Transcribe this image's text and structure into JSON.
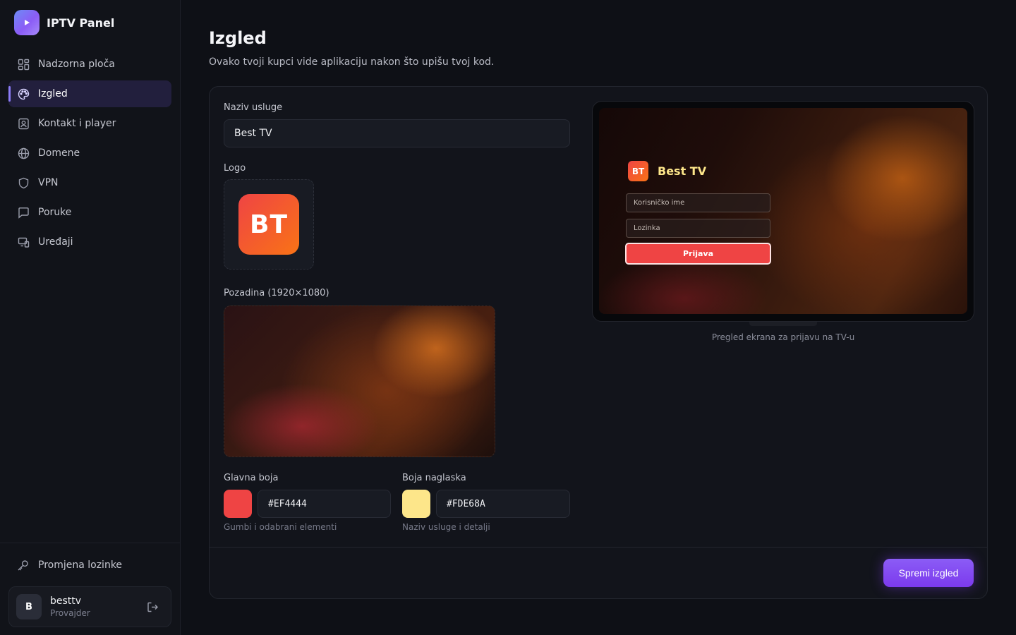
{
  "app": {
    "title": "IPTV Panel"
  },
  "sidebar": {
    "items": [
      {
        "label": "Nadzorna ploča",
        "icon": "dashboard-icon"
      },
      {
        "label": "Izgled",
        "icon": "palette-icon",
        "active": true
      },
      {
        "label": "Kontakt i player",
        "icon": "contact-icon"
      },
      {
        "label": "Domene",
        "icon": "globe-icon"
      },
      {
        "label": "VPN",
        "icon": "shield-icon"
      },
      {
        "label": "Poruke",
        "icon": "message-icon"
      },
      {
        "label": "Uređaji",
        "icon": "devices-icon"
      }
    ],
    "change_password": "Promjena lozinke",
    "user": {
      "initial": "B",
      "name": "besttv",
      "role": "Provajder"
    }
  },
  "page": {
    "title": "Izgled",
    "subtitle": "Ovako tvoji kupci vide aplikaciju nakon što upišu tvoj kod."
  },
  "form": {
    "service_name_label": "Naziv usluge",
    "service_name_value": "Best TV",
    "logo_label": "Logo",
    "logo_text": "BT",
    "background_label": "Pozadina (1920×1080)",
    "primary_color_label": "Glavna boja",
    "primary_color_value": "#EF4444",
    "primary_color_hint": "Gumbi i odabrani elementi",
    "accent_color_label": "Boja naglaska",
    "accent_color_value": "#FDE68A",
    "accent_color_hint": "Naziv usluge i detalji",
    "save_label": "Spremi izgled"
  },
  "preview": {
    "logo_text": "BT",
    "title": "Best TV",
    "username_placeholder": "Korisničko ime",
    "password_placeholder": "Lozinka",
    "login_label": "Prijava",
    "caption": "Pregled ekrana za prijavu na TV-u"
  },
  "colors": {
    "primary": "#EF4444",
    "accent": "#FDE68A",
    "brand": "#8B5CF6"
  }
}
